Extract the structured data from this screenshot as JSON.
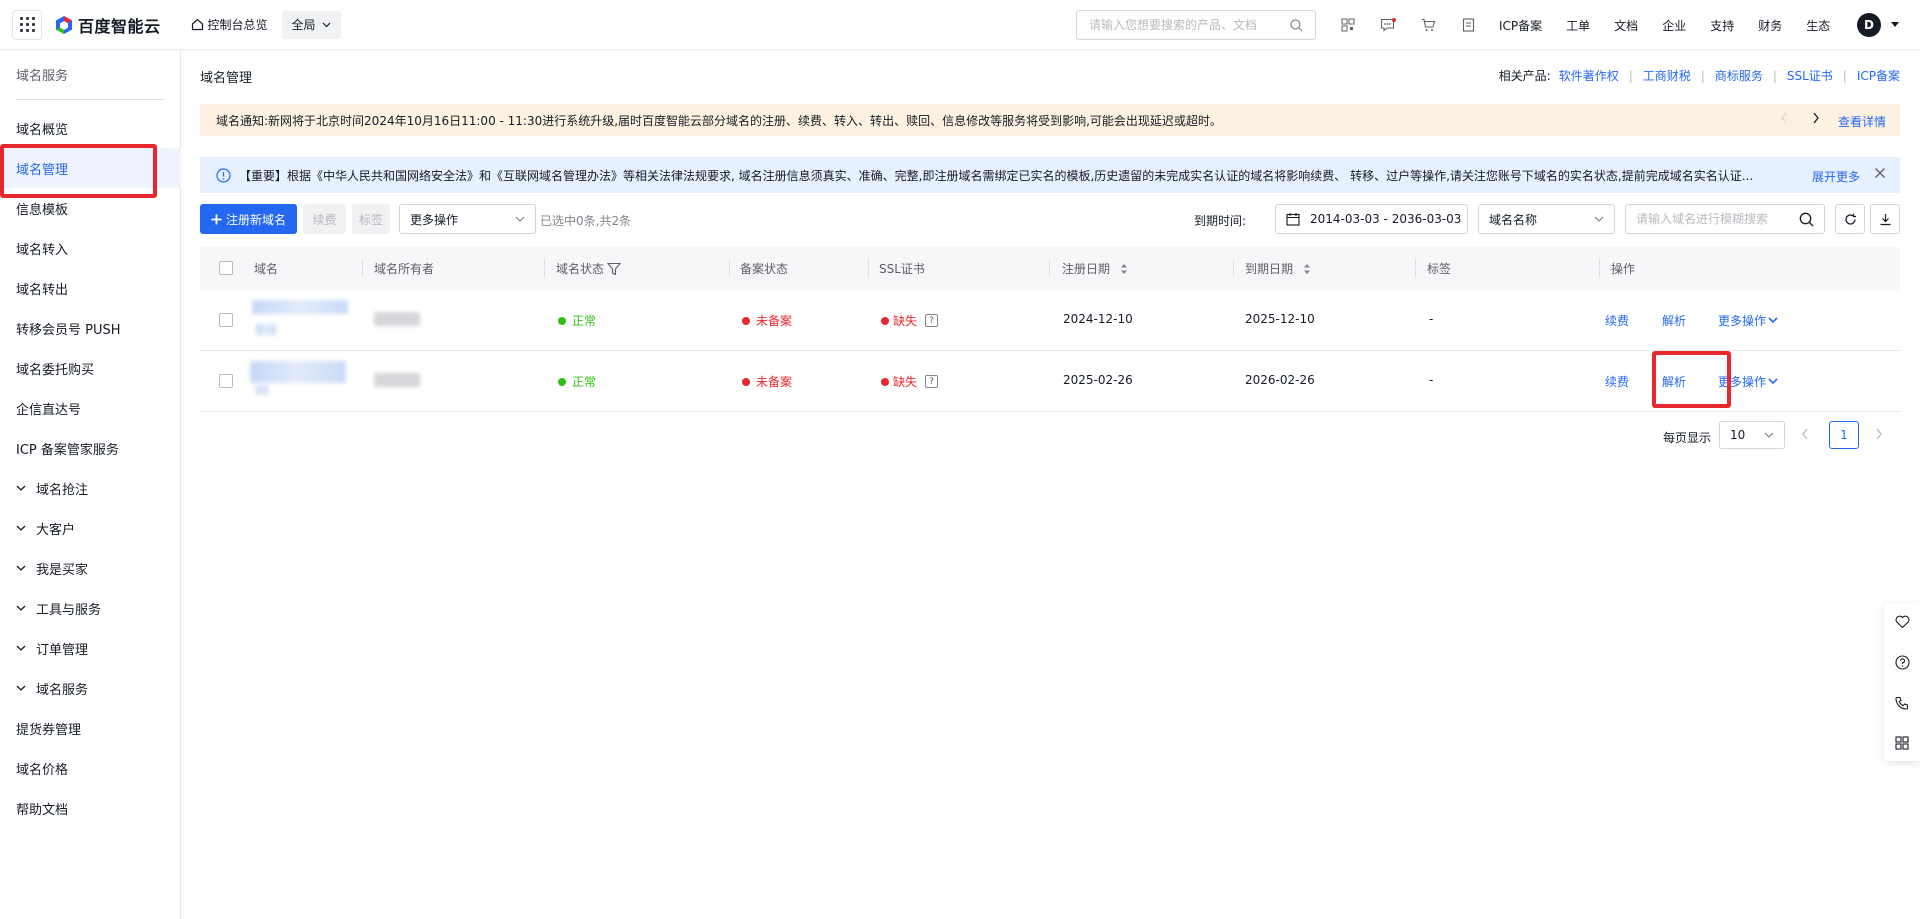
{
  "topbar": {
    "logo_text": "百度智能云",
    "home_label": "控制台总览",
    "region_label": "全局",
    "search_placeholder": "请输入您想要搜索的产品、文档",
    "nav": [
      "ICP备案",
      "工单",
      "文档",
      "企业",
      "支持",
      "财务",
      "生态"
    ],
    "avatar_letter": "D"
  },
  "sidebar": {
    "title": "域名服务",
    "items": [
      {
        "label": "域名概览",
        "expandable": false
      },
      {
        "label": "域名管理",
        "expandable": false,
        "active": true
      },
      {
        "label": "信息模板",
        "expandable": false
      },
      {
        "label": "域名转入",
        "expandable": false
      },
      {
        "label": "域名转出",
        "expandable": false
      },
      {
        "label": "转移会员号 PUSH",
        "expandable": false
      },
      {
        "label": "域名委托购买",
        "expandable": false
      },
      {
        "label": "企信直达号",
        "expandable": false
      },
      {
        "label": "ICP 备案管家服务",
        "expandable": false
      },
      {
        "label": "域名抢注",
        "expandable": true
      },
      {
        "label": "大客户",
        "expandable": true
      },
      {
        "label": "我是买家",
        "expandable": true
      },
      {
        "label": "工具与服务",
        "expandable": true
      },
      {
        "label": "订单管理",
        "expandable": true
      },
      {
        "label": "域名服务",
        "expandable": true
      },
      {
        "label": "提货券管理",
        "expandable": false
      },
      {
        "label": "域名价格",
        "expandable": false
      },
      {
        "label": "帮助文档",
        "expandable": false
      }
    ]
  },
  "main": {
    "page_title": "域名管理",
    "related_label": "相关产品:",
    "related_links": [
      "软件著作权",
      "工商财税",
      "商标服务",
      "SSL证书",
      "ICP备案"
    ],
    "notice_text": "域名通知:新网将于北京时间2024年10月16日11:00 - 11:30进行系统升级,届时百度智能云部分域名的注册、续费、转入、转出、赎回、信息修改等服务将受到影响,可能会出现延迟或超时。",
    "notice_detail": "查看详情",
    "banner_text": "【重要】根据《中华人民共和国网络安全法》和《互联网域名管理办法》等相关法律法规要求, 域名注册信息须真实、准确、完整,即注册域名需绑定已实名的模板,历史遗留的未完成实名认证的域名将影响续费、 转移、过户等操作,请关注您账号下域名的实名状态,提前完成域名实名认证...",
    "banner_expand": "展开更多"
  },
  "toolbar": {
    "register_label": "注册新域名",
    "renew_label": "续费",
    "tag_label": "标签",
    "more_ops_label": "更多操作",
    "selected_count": "已选中0条,共2条",
    "date_label": "到期时间:",
    "date_range": "2014-03-03 - 2036-03-03",
    "search_field": "域名名称",
    "search_placeholder": "请输入域名进行模糊搜索"
  },
  "table": {
    "headers": [
      "域名",
      "域名所有者",
      "域名状态",
      "备案状态",
      "SSL证书",
      "注册日期",
      "到期日期",
      "标签",
      "操作"
    ],
    "rows": [
      {
        "status": "正常",
        "beian": "未备案",
        "ssl": "缺失",
        "reg_date": "2024-12-10",
        "exp_date": "2025-12-10",
        "tag": "-",
        "op_renew": "续费",
        "op_resolve": "解析",
        "op_more": "更多操作"
      },
      {
        "status": "正常",
        "beian": "未备案",
        "ssl": "缺失",
        "reg_date": "2025-02-26",
        "exp_date": "2026-02-26",
        "tag": "-",
        "op_renew": "续费",
        "op_resolve": "解析",
        "op_more": "更多操作"
      }
    ]
  },
  "pagination": {
    "per_page_label": "每页显示",
    "per_page_value": "10",
    "current_page": "1"
  },
  "colors": {
    "primary": "#2468f2",
    "success": "#30bf13",
    "danger": "#e8282f",
    "highlight_box": "#e8282f"
  }
}
